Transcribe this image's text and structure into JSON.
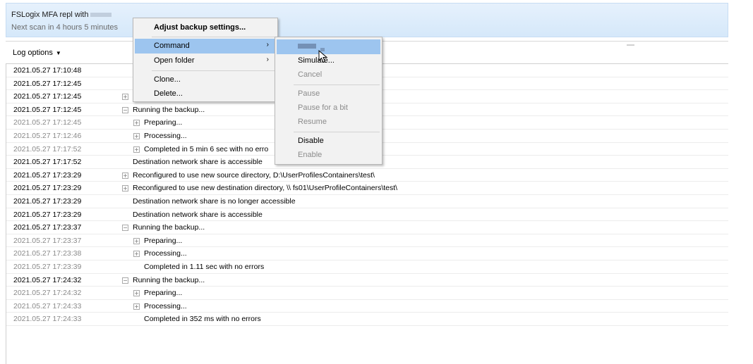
{
  "header": {
    "title": "FSLogix MFA repl with",
    "next_scan": "Next scan in 4 hours 5 minutes"
  },
  "log_bar": {
    "options_label": "Log options"
  },
  "main_menu": {
    "adjust": "Adjust backup settings...",
    "command": "Command",
    "open_folder": "Open folder",
    "clone": "Clone...",
    "delete": "Delete..."
  },
  "sub_menu": {
    "simulate": "Simulate...",
    "cancel": "Cancel",
    "pause": "Pause",
    "pause_bit": "Pause for a bit",
    "resume": "Resume",
    "disable": "Disable",
    "enable": "Enable"
  },
  "log_rows": [
    {
      "ts": "2021.05.27 17:10:48",
      "msg": "",
      "level": 0,
      "expander": "",
      "dim": false
    },
    {
      "ts": "2021.05.27 17:12:45",
      "msg": "",
      "level": 0,
      "expander": "",
      "dim": false
    },
    {
      "ts": "2021.05.27 17:12:45",
      "msg": "",
      "level": 0,
      "expander": "+",
      "dim": false
    },
    {
      "ts": "2021.05.27 17:12:45",
      "msg": "Running the backup...",
      "level": 0,
      "expander": "−",
      "dim": false
    },
    {
      "ts": "2021.05.27 17:12:45",
      "msg": "Preparing...",
      "level": 1,
      "expander": "+",
      "dim": true
    },
    {
      "ts": "2021.05.27 17:12:46",
      "msg": "Processing...",
      "level": 1,
      "expander": "+",
      "dim": true
    },
    {
      "ts": "2021.05.27 17:17:52",
      "msg": "Completed in 5 min 6 sec with no erro",
      "level": 1,
      "expander": "+",
      "dim": true
    },
    {
      "ts": "2021.05.27 17:17:52",
      "msg": "Destination network share is accessible",
      "level": 0,
      "expander": "",
      "dim": false
    },
    {
      "ts": "2021.05.27 17:23:29",
      "msg": "Reconfigured to use new source directory, D:\\UserProfilesContainers\\test\\",
      "level": 0,
      "expander": "+",
      "dim": false
    },
    {
      "ts": "2021.05.27 17:23:29",
      "msg": "Reconfigured to use new destination directory, \\\\         fs01\\UserProfileContainers\\test\\",
      "level": 0,
      "expander": "+",
      "dim": false
    },
    {
      "ts": "2021.05.27 17:23:29",
      "msg": "Destination network share is no longer accessible",
      "level": 0,
      "expander": "",
      "dim": false
    },
    {
      "ts": "2021.05.27 17:23:29",
      "msg": "Destination network share is accessible",
      "level": 0,
      "expander": "",
      "dim": false
    },
    {
      "ts": "2021.05.27 17:23:37",
      "msg": "Running the backup...",
      "level": 0,
      "expander": "−",
      "dim": false
    },
    {
      "ts": "2021.05.27 17:23:37",
      "msg": "Preparing...",
      "level": 1,
      "expander": "+",
      "dim": true
    },
    {
      "ts": "2021.05.27 17:23:38",
      "msg": "Processing...",
      "level": 1,
      "expander": "+",
      "dim": true
    },
    {
      "ts": "2021.05.27 17:23:39",
      "msg": "Completed in 1.11 sec with no errors",
      "level": 1,
      "expander": "",
      "dim": true
    },
    {
      "ts": "2021.05.27 17:24:32",
      "msg": "Running the backup...",
      "level": 0,
      "expander": "−",
      "dim": false
    },
    {
      "ts": "2021.05.27 17:24:32",
      "msg": "Preparing...",
      "level": 1,
      "expander": "+",
      "dim": true
    },
    {
      "ts": "2021.05.27 17:24:33",
      "msg": "Processing...",
      "level": 1,
      "expander": "+",
      "dim": true
    },
    {
      "ts": "2021.05.27 17:24:33",
      "msg": "Completed in 352 ms with no errors",
      "level": 1,
      "expander": "",
      "dim": true
    }
  ]
}
